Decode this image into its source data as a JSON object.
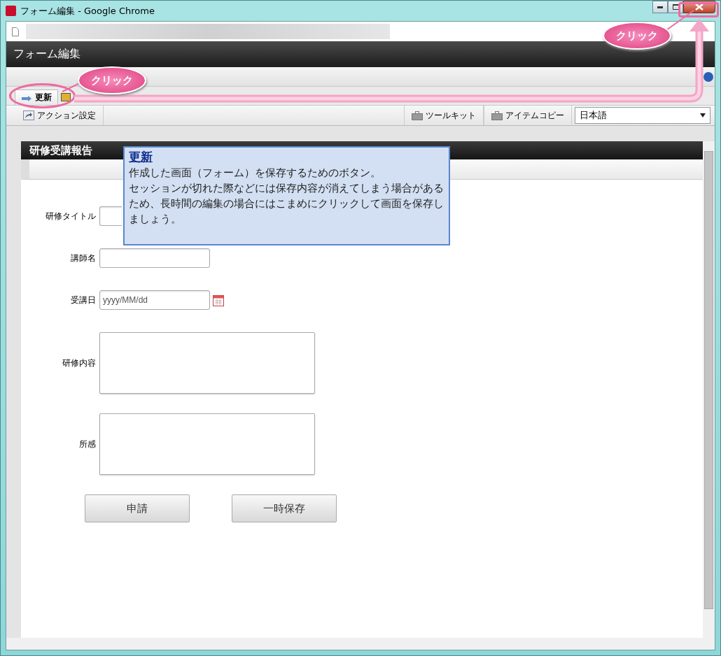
{
  "window": {
    "title": "フォーム編集 - Google Chrome"
  },
  "app_header": {
    "title": "フォーム編集"
  },
  "toolbar": {
    "update_button": "更新",
    "action_button": "アクション設定",
    "toolkit_button": "ツールキット",
    "item_copy_button": "アイテムコピー",
    "language_select": "日本語"
  },
  "form": {
    "title": "研修受講報告",
    "fields": [
      {
        "label": "研修タイトル",
        "kind": "text"
      },
      {
        "label": "講師名",
        "kind": "text"
      },
      {
        "label": "受講日",
        "kind": "date",
        "placeholder": "yyyy/MM/dd"
      },
      {
        "label": "研修内容",
        "kind": "textarea"
      },
      {
        "label": "所感",
        "kind": "textarea"
      }
    ],
    "buttons": [
      "申請",
      "一時保存"
    ]
  },
  "tooltip": {
    "title": "更新",
    "paragraphs": [
      "作成した画面（フォーム）を保存するためのボタン。",
      "セッションが切れた際などには保存内容が消えてしまう場合があるため、長時間の編集の場合にはこまめにクリックして画面を保存しましょう。"
    ]
  },
  "callouts": [
    "クリック",
    "クリック"
  ]
}
